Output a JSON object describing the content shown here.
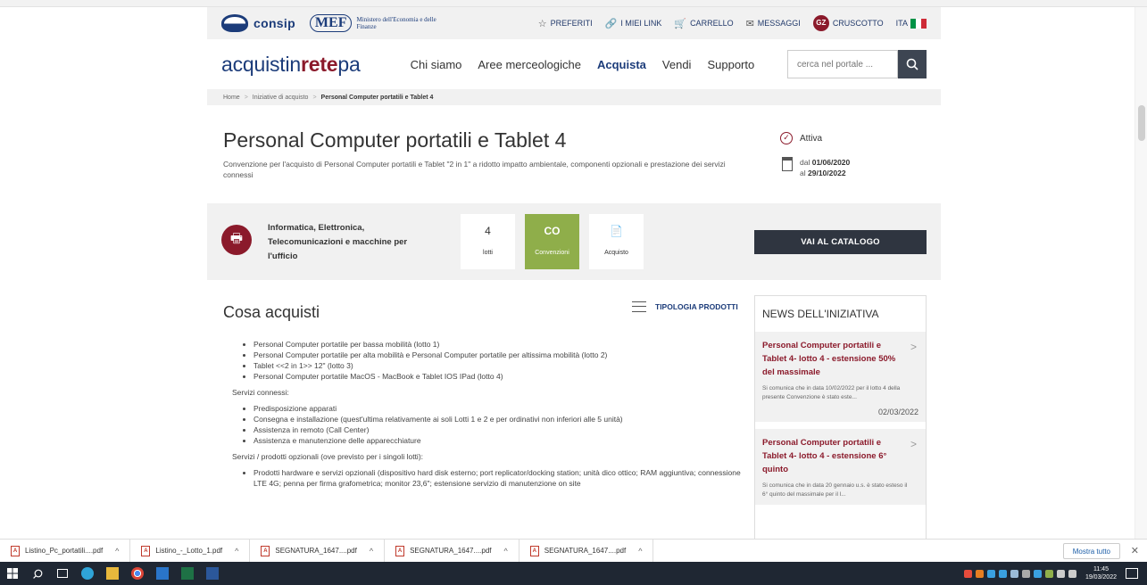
{
  "utility": {
    "consip_label": "consip",
    "mef_mark": "MEF",
    "mef_text": "Ministero dell'Economia e delle Finanze",
    "links": [
      {
        "icon": "☆",
        "label": "PREFERITI"
      },
      {
        "icon": "🔗",
        "label": "I MIEI LINK"
      },
      {
        "icon": "🛒",
        "label": "CARRELLO"
      },
      {
        "icon": "✉",
        "label": "MESSAGGI"
      }
    ],
    "user_badge": "GZ",
    "dashboard_label": "CRUSCOTTO",
    "lang": "ITA",
    "flag_colors": [
      "#009246",
      "#ffffff",
      "#ce2b37"
    ]
  },
  "nav": {
    "brand_part1": "acquistin",
    "brand_accent": "rete",
    "brand_part2": "pa",
    "items": [
      "Chi siamo",
      "Aree merceologiche",
      "Acquista",
      "Vendi",
      "Supporto"
    ],
    "active_index": 2,
    "search_placeholder": "cerca nel portale ..."
  },
  "breadcrumb": {
    "items": [
      "Home",
      "Iniziative di acquisto"
    ],
    "current": "Personal Computer portatili e Tablet 4"
  },
  "title": {
    "heading": "Personal Computer portatili e Tablet 4",
    "subtitle": "Convenzione per l'acquisto di Personal Computer portatili e Tablet \"2 in 1\" a ridotto impatto ambientale, componenti opzionali e prestazione dei servizi connessi",
    "status": "Attiva",
    "date_from_label": "dal",
    "date_from": "01/06/2020",
    "date_to_label": "al",
    "date_to": "29/10/2022"
  },
  "category": {
    "name": "Informatica, Elettronica, Telecomunicazioni e macchine per l'ufficio",
    "tiles": [
      {
        "top": "4",
        "bottom": "lotti"
      },
      {
        "top": "CO",
        "bottom": "Convenzioni"
      },
      {
        "top": "📄",
        "bottom": "Acquisto"
      }
    ],
    "catalog_button": "VAI AL CATALOGO"
  },
  "content": {
    "section_title": "Cosa acquisti",
    "tipologia_label": "TIPOLOGIA PRODOTTI",
    "list1": [
      "Personal Computer portatile per bassa mobilità (lotto 1)",
      "Personal Computer portatile per alta mobilità e Personal Computer portatile per altissima mobilità (lotto 2)",
      "Tablet <<2 in 1>> 12\" (lotto 3)",
      "Personal Computer portatile MacOS - MacBook e Tablet IOS IPad (lotto 4)"
    ],
    "para1": "Servizi connessi:",
    "list2": [
      "Predisposizione apparati",
      "Consegna e installazione (quest'ultima relativamente ai soli Lotti 1 e 2 e per ordinativi non inferiori alle 5 unità)",
      "Assistenza in remoto (Call Center)",
      "Assistenza e manutenzione delle apparecchiature"
    ],
    "para2": "Servizi / prodotti opzionali (ove previsto per i singoli lotti):",
    "list3": [
      "Prodotti hardware e servizi opzionali (dispositivo hard disk esterno; port replicator/docking station; unità dico ottico; RAM aggiuntiva; connessione LTE 4G; penna per firma grafometrica; monitor 23,6\"; estensione servizio di manutenzione on site"
    ]
  },
  "news": {
    "header": "NEWS DELL'INIZIATIVA",
    "items": [
      {
        "title": "Personal Computer portatili e Tablet 4- lotto 4 - estensione 50% del massimale",
        "text": "Si comunica che in data 10/02/2022 per il lotto 4 della presente Convenzione è stato este...",
        "date": "02/03/2022"
      },
      {
        "title": "Personal Computer portatili e Tablet 4- lotto 4 - estensione 6° quinto",
        "text": "Si comunica che in data 20 gennaio u.s. è stato esteso il 6° quinto del massimale per il l...",
        "date": ""
      }
    ]
  },
  "downloads": {
    "files": [
      "Listino_Pc_portatili....pdf",
      "Listino_-_Lotto_1.pdf",
      "SEGNATURA_1647....pdf",
      "SEGNATURA_1647....pdf",
      "SEGNATURA_1647....pdf"
    ],
    "show_all": "Mostra tutto"
  },
  "taskbar": {
    "time": "11:45",
    "date": "19/03/2022"
  }
}
